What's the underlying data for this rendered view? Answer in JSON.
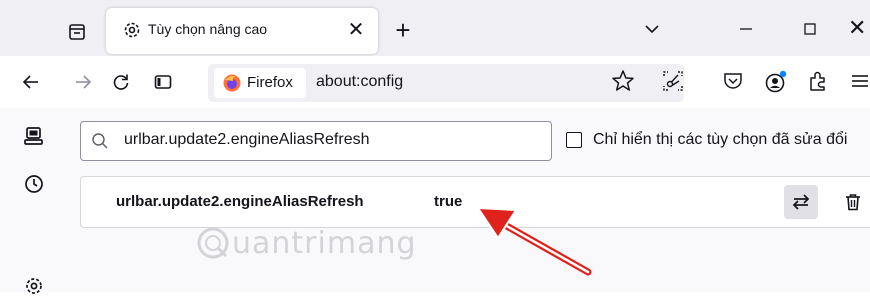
{
  "tab": {
    "title": "Tùy chọn nâng cao",
    "close": "✕"
  },
  "new_tab": "+",
  "window": {
    "close": "✕"
  },
  "urlbar": {
    "identity": "Firefox",
    "url": "about:config"
  },
  "search": {
    "value": "urlbar.update2.engineAliasRefresh"
  },
  "modified_only": {
    "label": "Chỉ hiển thị các tùy chọn đã sửa đổi",
    "checked": false
  },
  "preference": {
    "name": "urlbar.update2.engineAliasRefresh",
    "value": "true"
  },
  "watermark": {
    "text": "uantrimang"
  },
  "colors": {
    "arrow": "#e0221c",
    "firefox_orange": "#ff7139",
    "account_dot": "#0a84ff"
  },
  "icons": [
    "tab-list-icon",
    "settings-gear-icon",
    "chevron-down-icon",
    "minimize-icon",
    "maximize-icon",
    "close-icon",
    "back-arrow-icon",
    "forward-arrow-icon",
    "reload-icon",
    "sidebar-icon",
    "firefox-logo-icon",
    "bookmark-star-icon",
    "screenshot-icon",
    "pocket-icon",
    "account-icon",
    "extensions-icon",
    "hamburger-menu-icon",
    "sync-tabs-icon",
    "history-clock-icon",
    "search-icon",
    "toggle-arrows-icon",
    "trash-icon"
  ]
}
